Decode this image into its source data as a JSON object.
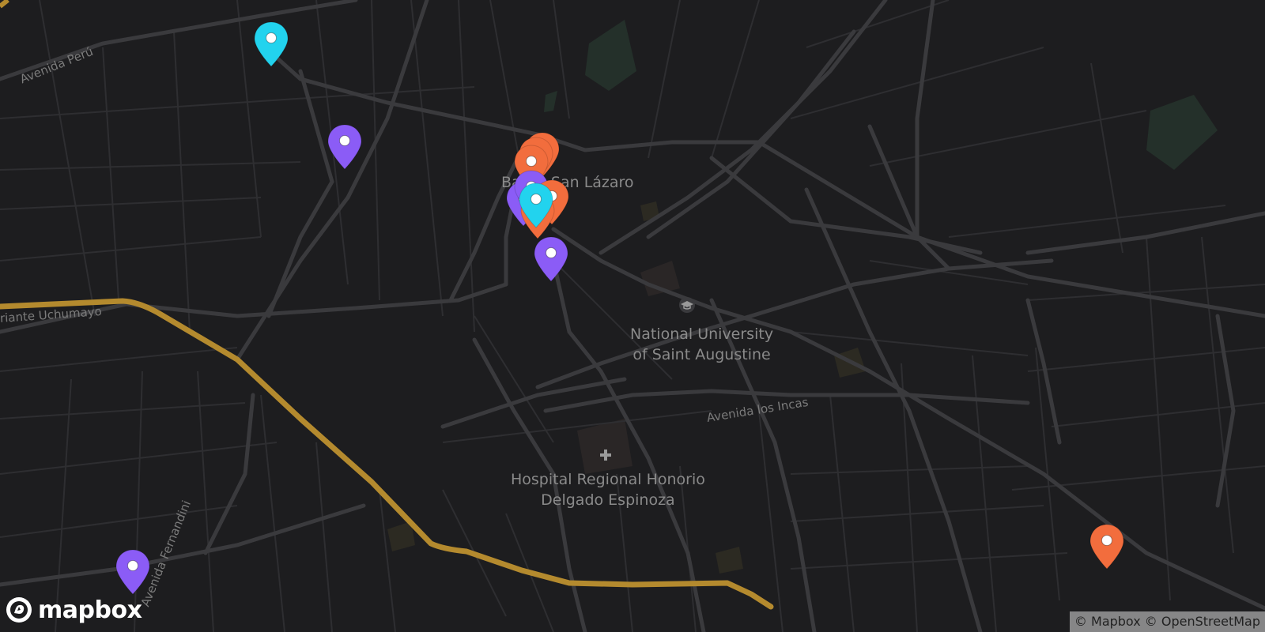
{
  "map": {
    "theme": "dark",
    "colors": {
      "background": "#1d1d1f",
      "road": "#3a3a3d",
      "highway": "#a8812e",
      "park": "#252f28",
      "marker_orange": "#f26d3d",
      "marker_purple": "#8b5cf6",
      "marker_cyan": "#22d3ee"
    },
    "street_labels": {
      "avenida_peru": "Avenida Perú",
      "uchumayo": "riante Uchumayo",
      "avenida_los_incas": "Avenida los Incas",
      "avenida_fernandini": "Avenida Fernandini"
    },
    "poi_labels": {
      "barrio": "Barrio San Lázaro",
      "university": [
        "National University",
        "of Saint Augustine"
      ],
      "hospital": [
        "Hospital Regional Honorio",
        "Delgado Espinoza"
      ]
    },
    "poi_icons": {
      "university": "graduation-cap-icon",
      "hospital": "hospital-cross-icon"
    },
    "markers": [
      {
        "name": "marker-cyan-1",
        "color": "cyan"
      },
      {
        "name": "marker-purple-1",
        "color": "purple"
      },
      {
        "name": "marker-orange-cluster-1",
        "color": "orange"
      },
      {
        "name": "marker-orange-cluster-2",
        "color": "orange"
      },
      {
        "name": "marker-orange-cluster-3",
        "color": "orange"
      },
      {
        "name": "marker-purple-2",
        "color": "purple"
      },
      {
        "name": "marker-purple-3",
        "color": "purple"
      },
      {
        "name": "marker-orange-4",
        "color": "orange"
      },
      {
        "name": "marker-orange-5",
        "color": "orange"
      },
      {
        "name": "marker-cyan-2",
        "color": "cyan"
      },
      {
        "name": "marker-purple-4",
        "color": "purple"
      },
      {
        "name": "marker-orange-6",
        "color": "orange"
      },
      {
        "name": "marker-purple-5",
        "color": "purple"
      }
    ],
    "branding": {
      "logo_text": "mapbox",
      "logo_icon": "mapbox-logo-icon"
    },
    "attribution": {
      "mapbox": "© Mapbox",
      "osm": "© OpenStreetMap"
    }
  }
}
